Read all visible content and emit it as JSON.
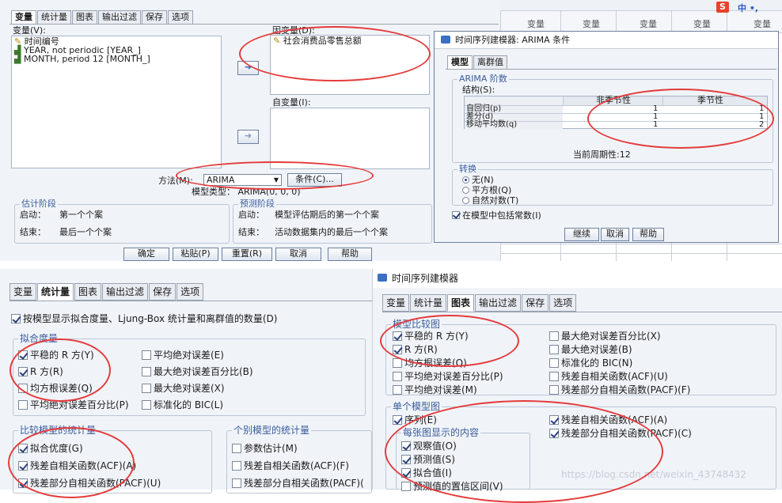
{
  "top_dialog": {
    "tabs": [
      "变量",
      "统计量",
      "图表",
      "输出过滤",
      "保存",
      "选项"
    ],
    "variables_label": "变量(V):",
    "variables": [
      "时间编号",
      "YEAR, not periodic [YEAR_]",
      "MONTH, period 12 [MONTH_]"
    ],
    "dependent_label": "因变量(D):",
    "dependent_value": "社会消费品零售总额",
    "independent_label": "自变量(I):",
    "method_label": "方法(M):",
    "method_value": "ARIMA",
    "criteria_button": "条件(C)...",
    "model_type": "模型类型：  ARIMA(0, 0, 0)",
    "est_period": {
      "title": "估计阶段",
      "start_label": "启动：",
      "start_value": "第一个个案",
      "end_label": "结束：",
      "end_value": "最后一个个案"
    },
    "fcst_period": {
      "title": "预测阶段",
      "start_label": "启动：",
      "start_value": "模型评估期后的第一个个案",
      "end_label": "结束：",
      "end_value": "活动数据集内的最后一个个案"
    },
    "buttons": [
      "确定",
      "粘贴(P)",
      "重置(R)",
      "取消",
      "帮助"
    ]
  },
  "grid": {
    "header": "变量"
  },
  "ime": {
    "logo": "S",
    "text": "中 •,"
  },
  "arima": {
    "title": "时间序列建模器: ARIMA 条件",
    "tabs": [
      "模型",
      "离群值"
    ],
    "orders_group": "ARIMA 阶数",
    "structure_label": "结构(S):",
    "col_nonseasonal": "非季节性",
    "col_seasonal": "季节性",
    "rows": [
      {
        "label": "自回归(p)",
        "ns": "1",
        "s": "1"
      },
      {
        "label": "差分(d)",
        "ns": "1",
        "s": "1"
      },
      {
        "label": "移动平均数(q)",
        "ns": "1",
        "s": "2"
      }
    ],
    "period": "当前周期性:12",
    "transform_group": "转换",
    "transforms": [
      "无(N)",
      "平方根(Q)",
      "自然对数(T)"
    ],
    "include_constant": "在模型中包括常数(I)",
    "buttons": [
      "继续",
      "取消",
      "帮助"
    ]
  },
  "stats": {
    "tabs": [
      "变量",
      "统计量",
      "图表",
      "输出过滤",
      "保存",
      "选项"
    ],
    "display_fit": "按模型显示拟合度量、Ljung-Box 统计量和离群值的数量(D)",
    "fit_group": "拟合度量",
    "fit_left": [
      "平稳的 R 方(Y)",
      "R 方(R)",
      "均方根误差(Q)",
      "平均绝对误差百分比(P)"
    ],
    "fit_right": [
      "平均绝对误差(E)",
      "最大绝对误差百分比(B)",
      "最大绝对误差(X)",
      "标准化的 BIC(L)"
    ],
    "compare_group": "比较模型的统计量",
    "compare_items": [
      "拟合优度(G)",
      "残差自相关函数(ACF)(A)",
      "残差部分自相关函数(PACF)(U)"
    ],
    "indiv_group": "个别模型的统计量",
    "indiv_items": [
      "参数估计(M)",
      "残差自相关函数(ACF)(F)",
      "残差部分自相关函数(PACF)("
    ]
  },
  "plots": {
    "title": "时间序列建模器",
    "tabs": [
      "变量",
      "统计量",
      "图表",
      "输出过滤",
      "保存",
      "选项"
    ],
    "compare_group": "模型比较图",
    "compare_left": [
      "平稳的 R 方(Y)",
      "R 方(R)",
      "均方根误差(Q)",
      "平均绝对误差百分比(P)",
      "平均绝对误差(M)"
    ],
    "compare_right": [
      "最大绝对误差百分比(X)",
      "最大绝对误差(B)",
      "标准化的 BIC(N)",
      "残差自相关函数(ACF)(U)",
      "残差部分自相关函数(PACF)(F)"
    ],
    "indiv_group": "单个模型图",
    "series": "序列(E)",
    "each_plot_group": "每张图显示的内容",
    "each_items": [
      "观察值(O)",
      "预测值(S)",
      "拟合值(I)",
      "预测值的置信区间(V)"
    ],
    "indiv_right": [
      "残差自相关函数(ACF)(A)",
      "残差部分自相关函数(PACF)(C)"
    ]
  },
  "watermark": "https://blog.csdn.net/weixin_43748432"
}
